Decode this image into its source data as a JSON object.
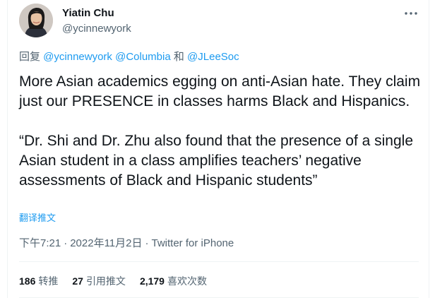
{
  "author": {
    "display_name": "Yiatin Chu",
    "handle": "@ycinnewyork",
    "avatar_icon": "profile-photo"
  },
  "more_icon": "more-dots-icon",
  "reply": {
    "prefix": "回复 ",
    "mention1": "@ycinnewyork",
    "mention2": "@Columbia",
    "joiner": " 和 ",
    "mention3": "@JLeeSoc"
  },
  "tweet": {
    "paragraph1": "More Asian academics egging on anti-Asian hate. They claim just our PRESENCE in classes harms Black and Hispanics.",
    "paragraph2": "“Dr. Shi and Dr. Zhu also found that the presence of a single Asian student in a class amplifies teachers’ negative assessments of Black and Hispanic students”"
  },
  "translate_label": "翻译推文",
  "meta": {
    "time": "下午7:21",
    "separator": "·",
    "date": "2022年11月2日",
    "source": "Twitter for iPhone"
  },
  "stats": {
    "retweets": {
      "count": "186",
      "label": "转推"
    },
    "quotes": {
      "count": "27",
      "label": "引用推文"
    },
    "likes": {
      "count": "2,179",
      "label": "喜欢次数"
    }
  },
  "colors": {
    "link": "#1d9bf0",
    "secondary_text": "#536471",
    "primary_text": "#0f1419",
    "divider": "#eff3f4"
  }
}
